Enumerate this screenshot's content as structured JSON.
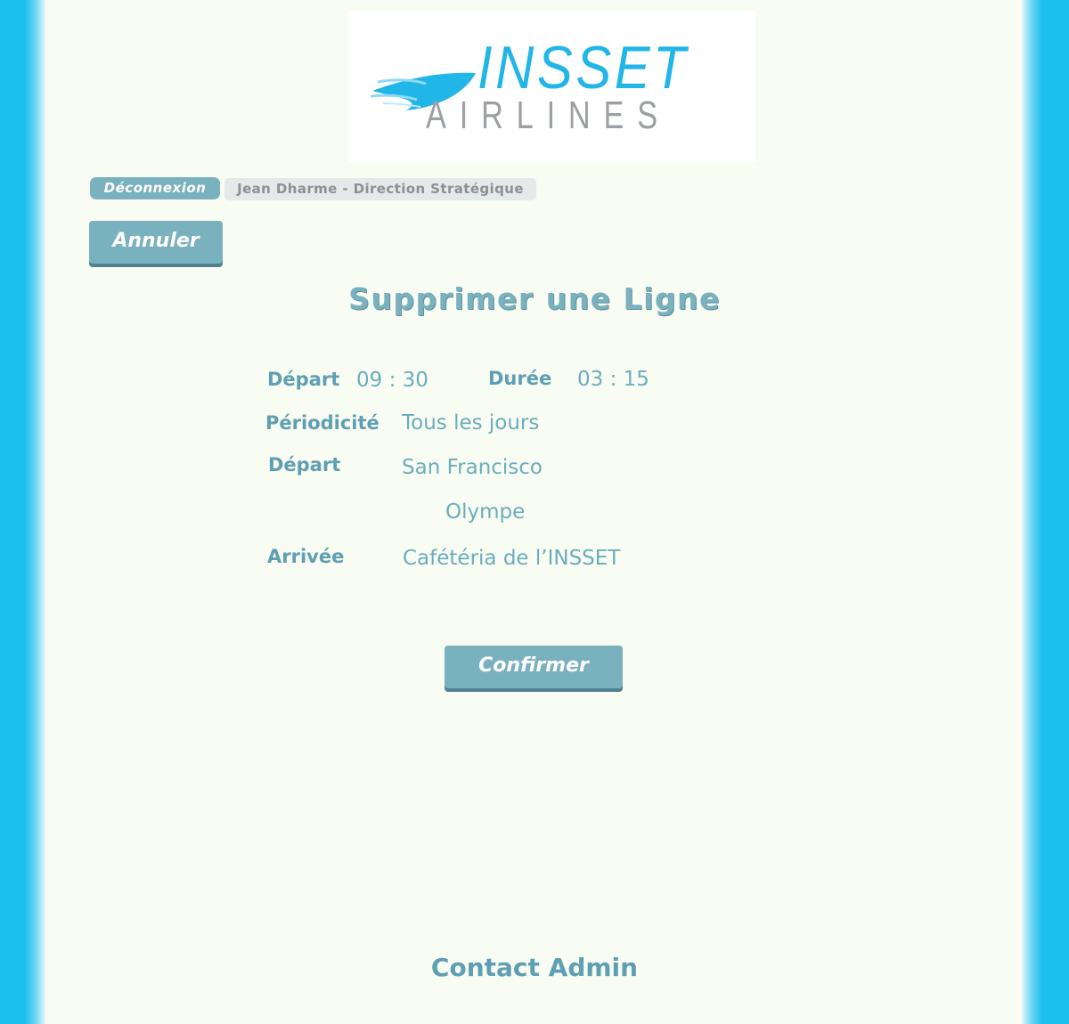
{
  "logo": {
    "brand_line1": "INSSET",
    "brand_line2": "AIRLINES",
    "colors": {
      "brand_blue": "#22b6e8",
      "brand_grey": "#9c9fa3"
    }
  },
  "session": {
    "logout_label": "Déconnexion",
    "user_label": "Jean Dharme - Direction Stratégique"
  },
  "actions": {
    "cancel_label": "Annuler",
    "confirm_label": "Confirmer"
  },
  "page_title": "Supprimer une Ligne",
  "details": {
    "departure_time_label": "Départ",
    "departure_time_value": "09 : 30",
    "duration_label": "Durée",
    "duration_value": "03 : 15",
    "periodicity_label": "Périodicité",
    "periodicity_value": "Tous les jours",
    "departure_label": "Départ",
    "departure_value": "San Francisco",
    "stopover_value": "Olympe",
    "arrival_label": "Arrivée",
    "arrival_value": "Cafétéria de l’INSSET"
  },
  "footer": {
    "contact_label": "Contact Admin"
  },
  "colors": {
    "background_side": "#1dbfee",
    "page_background": "#f9fcf2",
    "button": "#7ab1bf",
    "text_accent": "#5e9fb3"
  }
}
